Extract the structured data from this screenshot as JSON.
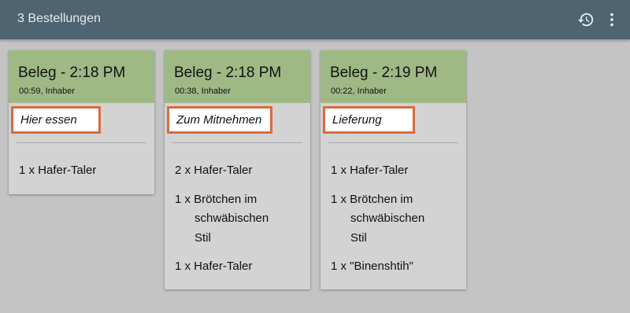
{
  "appbar": {
    "title": "3 Bestellungen",
    "icons": [
      "history-icon",
      "more-vert-icon"
    ]
  },
  "colors": {
    "appbar": "#4e6470",
    "card_header": "#9fb985",
    "card_body": "#d3d3d3",
    "highlight_border": "#d86a3f",
    "background": "#c4c4c4"
  },
  "orders": [
    {
      "title": "Beleg - 2:18 PM",
      "subtitle": "00:59, Inhaber",
      "type": "Hier essen",
      "items": [
        "1 x Hafer-Taler"
      ]
    },
    {
      "title": "Beleg - 2:18 PM",
      "subtitle": "00:38, Inhaber",
      "type": "Zum Mitnehmen",
      "items": [
        "2 x Hafer-Taler",
        "1 x Brötchen im schwäbischen Stil",
        "1 x Hafer-Taler"
      ]
    },
    {
      "title": "Beleg - 2:19 PM",
      "subtitle": "00:22, Inhaber",
      "type": "Lieferung",
      "items": [
        "1 x Hafer-Taler",
        "1 x Brötchen im schwäbischen Stil",
        "1 x \"Binenshtih\""
      ]
    }
  ]
}
